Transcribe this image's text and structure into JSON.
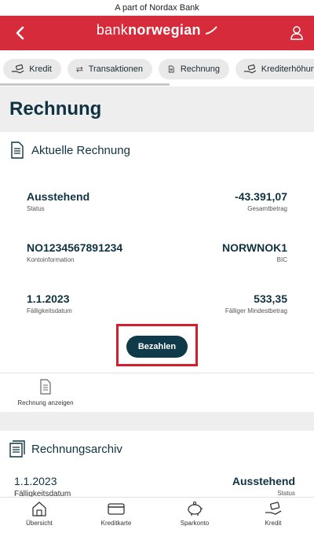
{
  "topbar": {
    "text": "A part of Nordax Bank"
  },
  "header": {
    "logo_light": "bank",
    "logo_bold": "norwegian"
  },
  "tabs": [
    {
      "label": "Kredit",
      "icon": "hand-card-icon"
    },
    {
      "label": "Transaktionen",
      "icon": "arrows-icon"
    },
    {
      "label": "Rechnung",
      "icon": "document-icon"
    },
    {
      "label": "Krediterhöhung",
      "icon": "hand-card-icon"
    }
  ],
  "page": {
    "title": "Rechnung"
  },
  "current_bill": {
    "title": "Aktuelle Rechnung",
    "status_value": "Ausstehend",
    "status_label": "Status",
    "total_value": "-43.391,07",
    "total_label": "Gesamtbetrag",
    "account_value": "NO1234567891234",
    "account_label": "Kontoinformation",
    "bic_value": "NORWNOK1",
    "bic_label": "BIC",
    "due_value": "1.1.2023",
    "due_label": "Fälligkeitsdatum",
    "min_value": "533,35",
    "min_label": "Fälliger Mindestbetrag",
    "pay_button": "Bezahlen",
    "view_link": "Rechnung anzeigen"
  },
  "archive": {
    "title": "Rechnungsarchiv",
    "due_value": "1.1.2023",
    "due_label": "Fälligkeitsdatum",
    "status_value": "Ausstehend",
    "status_label": "Status"
  },
  "bottom_nav": [
    {
      "label": "Übersicht",
      "icon": "home-icon"
    },
    {
      "label": "Kreditkarte",
      "icon": "credit-card-icon"
    },
    {
      "label": "Sparkonto",
      "icon": "piggy-bank-icon"
    },
    {
      "label": "Kredit",
      "icon": "hand-card-icon"
    }
  ],
  "colors": {
    "brand_red": "#d52b3a",
    "primary_dark": "#0e3a4a",
    "highlight": "#d21f2d"
  }
}
